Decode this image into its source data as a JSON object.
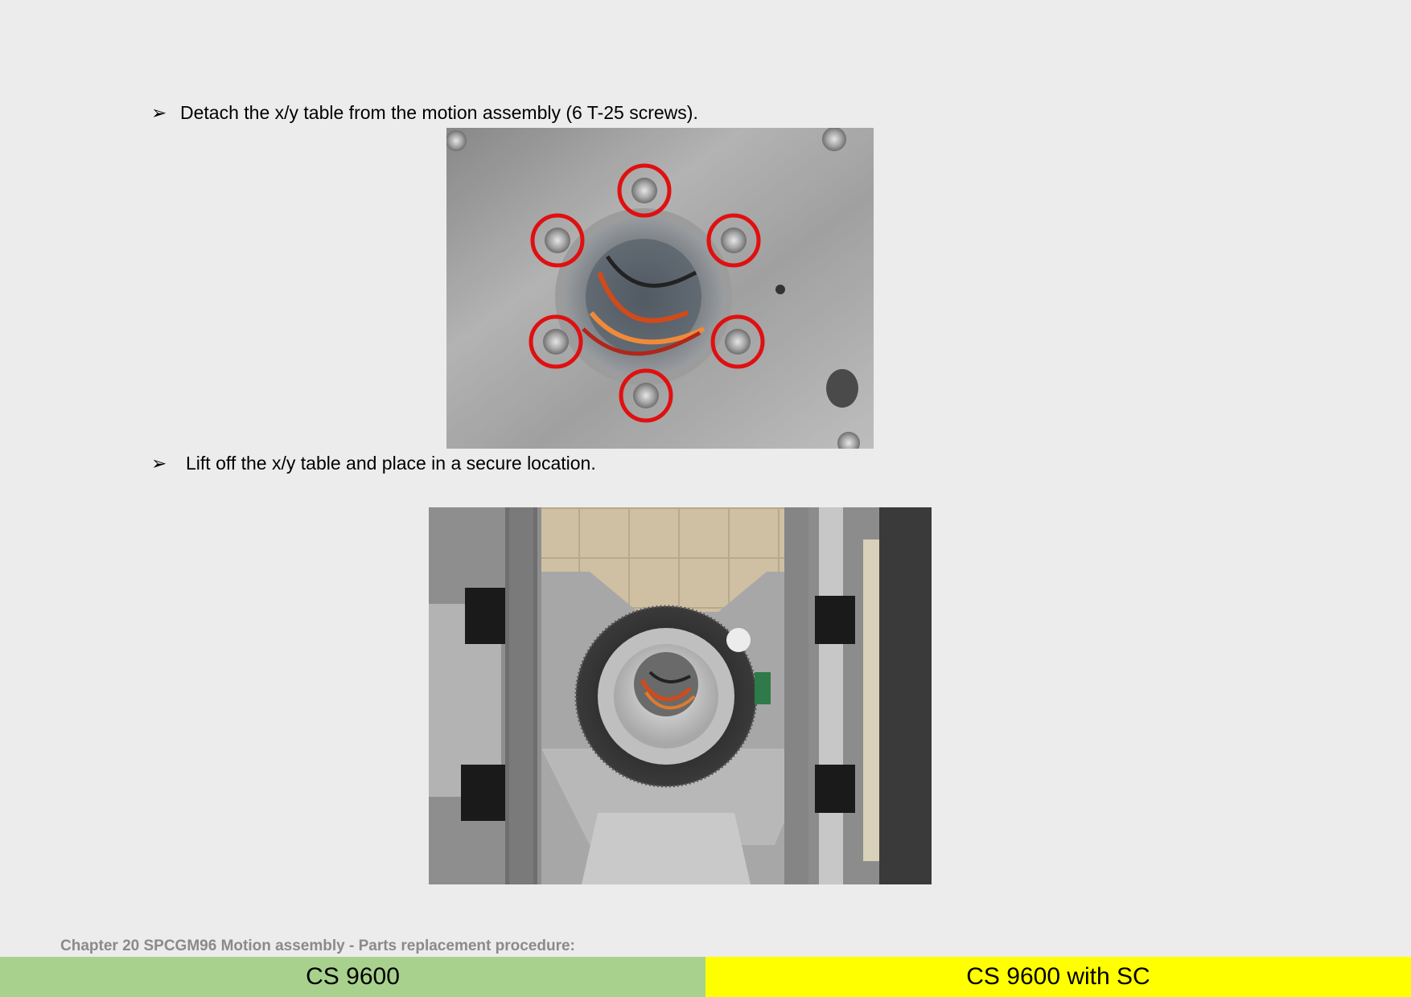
{
  "steps": [
    {
      "marker": "➢",
      "text": "Detach the x/y table from the motion assembly (6 T-25 screws)."
    },
    {
      "marker": "➢",
      "text": "Lift off the x/y table and place in a secure location."
    }
  ],
  "images": [
    {
      "name": "xy-table-screws-photo",
      "highlight_color": "#e01010",
      "highlighted_screw_count": 6
    },
    {
      "name": "motion-assembly-photo"
    }
  ],
  "footer": {
    "chapter": "Chapter 20 SPCGM96 Motion assembly - Parts replacement procedure:",
    "left_label": "CS 9600",
    "right_label": "CS 9600 with SC",
    "left_color": "#a9d18e",
    "right_color": "#ffff00"
  }
}
